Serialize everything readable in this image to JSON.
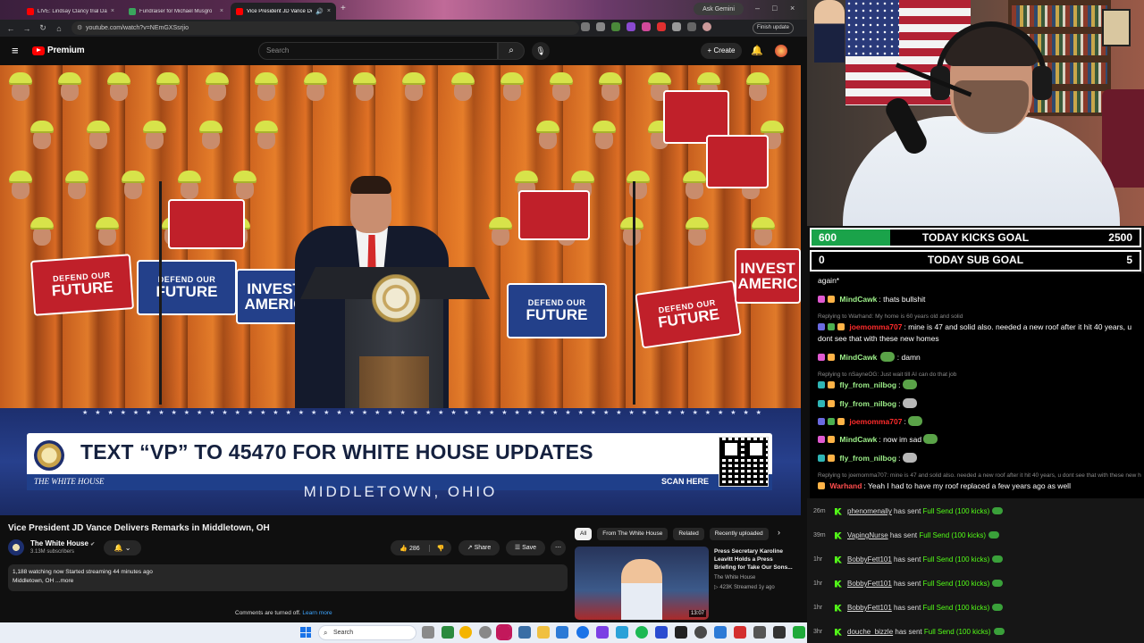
{
  "browser": {
    "tabs": [
      {
        "title": "LIVE: Lindsay Clancy trial Day 1",
        "favicon_color": "#ff0000"
      },
      {
        "title": "Fundraiser for Michael Musgro",
        "favicon_color": "#3aa55d"
      },
      {
        "title": "Vice President JD Vance De",
        "favicon_color": "#ff0000"
      }
    ],
    "ask_gemini": "Ask Gemini",
    "url": "youtube.com/watch?v=NEmGXSsrjio",
    "finish_update": "Finish update"
  },
  "youtube": {
    "logo": "Premium",
    "search_placeholder": "Search",
    "create_label": "+ Create",
    "video": {
      "banner_text": "TEXT “VP” TO 45470 FOR WHITE HOUSE UPDATES",
      "banner_logo": "THE WHITE HOUSE",
      "scan_here": "SCAN HERE",
      "location": "MIDDLETOWN, OHIO",
      "sign_defend_l1": "DEFEND OUR",
      "sign_defend_l2": "FUTURE",
      "sign_invest_l1": "INVEST",
      "sign_invest_l2": "AMERIC"
    },
    "title": "Vice President JD Vance Delivers Remarks in Middletown, OH",
    "channel": {
      "name": "The White House",
      "subs": "3.13M subscribers"
    },
    "likes": "286",
    "share_label": "Share",
    "save_label": "Save",
    "description": {
      "line1": "1,188 watching now  Started streaming 44 minutes ago",
      "line2": "Middletown, OH ...more"
    },
    "comments_off": "Comments are turned off.",
    "learn_more": "Learn more",
    "chips": [
      "All",
      "From The White House",
      "Related",
      "Recently uploaded"
    ],
    "recommended": {
      "title": "Press Secretary Karoline Leavitt Holds a Press Briefing for Take Our Sons...",
      "channel": "The White House",
      "meta": "▷ 423K  Streamed 1y ago",
      "duration": "13:07"
    }
  },
  "overlay": {
    "kicks_goal": {
      "current": "600",
      "label": "TODAY KICKS GOAL",
      "target": "2500",
      "progress": 0.24
    },
    "sub_goal": {
      "current": "0",
      "label": "TODAY SUB GOAL",
      "target": "5",
      "progress": 0
    }
  },
  "chat": {
    "top_fragment": "again*",
    "colors": {
      "mindcawk": "#9ef08a",
      "joemomma707": "#ff2b2b",
      "fly": "#9ef08a",
      "warhand": "#ff4d4d",
      "reply": "#8a8a8a"
    },
    "messages": [
      {
        "user": "MindCawk",
        "text": ": thats bullshit"
      },
      {
        "reply": "Replying to Warhand: My home is 60 years old and solid"
      },
      {
        "user": "joemomma707",
        "text": ": mine is 47 and solid also. needed a new roof after it hit 40 years, u dont see that with these new homes"
      },
      {
        "user": "MindCawk",
        "text": ": damn"
      },
      {
        "reply": "Replying to nSayneOG: Just wait till AI can do that job"
      },
      {
        "user": "fly_from_nilbog",
        "text": ":"
      },
      {
        "user": "fly_from_nilbog",
        "text": ":"
      },
      {
        "user": "joemomma707",
        "text": ":"
      },
      {
        "user": "MindCawk",
        "text": ": now im sad"
      },
      {
        "user": "fly_from_nilbog",
        "text": ":"
      },
      {
        "reply": "Replying to joemomma707: mine is 47 and solid also. needed a new roof after it hit 40 years, u dont see that with these new homes"
      },
      {
        "user": "Warhand",
        "text": ": Yeah I had to have my roof replaced a few years ago as well"
      }
    ]
  },
  "alerts": [
    {
      "time": "26m",
      "name": "phenomenally",
      "action": "has sent",
      "gift": "Full Send (100 kicks)"
    },
    {
      "time": "39m",
      "name": "VapingNurse",
      "action": "has sent",
      "gift": "Full Send (100 kicks)"
    },
    {
      "time": "1hr",
      "name": "BobbyFett101",
      "action": "has sent",
      "gift": "Full Send (100 kicks)"
    },
    {
      "time": "1hr",
      "name": "BobbyFett101",
      "action": "has sent",
      "gift": "Full Send (100 kicks)"
    },
    {
      "time": "1hr",
      "name": "BobbyFett101",
      "action": "has sent",
      "gift": "Full Send (100 kicks)"
    },
    {
      "time": "3hr",
      "name": "douche_bizzle",
      "action": "has sent",
      "gift": "Full Send (100 kicks)"
    }
  ],
  "taskbar": {
    "search_placeholder": "Search"
  }
}
